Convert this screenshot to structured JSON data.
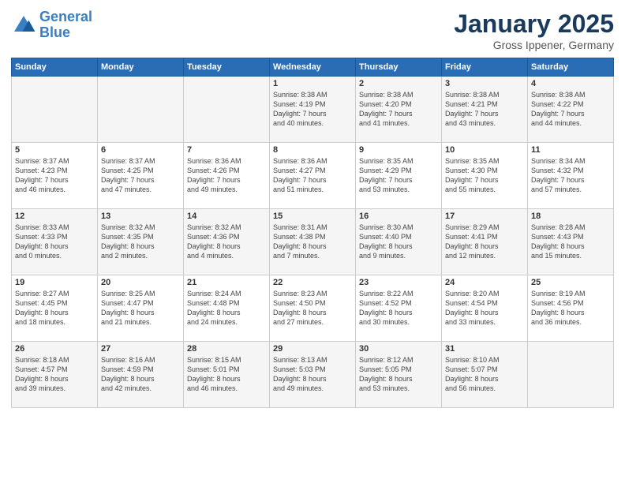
{
  "header": {
    "logo_line1": "General",
    "logo_line2": "Blue",
    "month_title": "January 2025",
    "location": "Gross Ippener, Germany"
  },
  "days_of_week": [
    "Sunday",
    "Monday",
    "Tuesday",
    "Wednesday",
    "Thursday",
    "Friday",
    "Saturday"
  ],
  "weeks": [
    [
      {
        "day": "",
        "content": ""
      },
      {
        "day": "",
        "content": ""
      },
      {
        "day": "",
        "content": ""
      },
      {
        "day": "1",
        "content": "Sunrise: 8:38 AM\nSunset: 4:19 PM\nDaylight: 7 hours\nand 40 minutes."
      },
      {
        "day": "2",
        "content": "Sunrise: 8:38 AM\nSunset: 4:20 PM\nDaylight: 7 hours\nand 41 minutes."
      },
      {
        "day": "3",
        "content": "Sunrise: 8:38 AM\nSunset: 4:21 PM\nDaylight: 7 hours\nand 43 minutes."
      },
      {
        "day": "4",
        "content": "Sunrise: 8:38 AM\nSunset: 4:22 PM\nDaylight: 7 hours\nand 44 minutes."
      }
    ],
    [
      {
        "day": "5",
        "content": "Sunrise: 8:37 AM\nSunset: 4:23 PM\nDaylight: 7 hours\nand 46 minutes."
      },
      {
        "day": "6",
        "content": "Sunrise: 8:37 AM\nSunset: 4:25 PM\nDaylight: 7 hours\nand 47 minutes."
      },
      {
        "day": "7",
        "content": "Sunrise: 8:36 AM\nSunset: 4:26 PM\nDaylight: 7 hours\nand 49 minutes."
      },
      {
        "day": "8",
        "content": "Sunrise: 8:36 AM\nSunset: 4:27 PM\nDaylight: 7 hours\nand 51 minutes."
      },
      {
        "day": "9",
        "content": "Sunrise: 8:35 AM\nSunset: 4:29 PM\nDaylight: 7 hours\nand 53 minutes."
      },
      {
        "day": "10",
        "content": "Sunrise: 8:35 AM\nSunset: 4:30 PM\nDaylight: 7 hours\nand 55 minutes."
      },
      {
        "day": "11",
        "content": "Sunrise: 8:34 AM\nSunset: 4:32 PM\nDaylight: 7 hours\nand 57 minutes."
      }
    ],
    [
      {
        "day": "12",
        "content": "Sunrise: 8:33 AM\nSunset: 4:33 PM\nDaylight: 8 hours\nand 0 minutes."
      },
      {
        "day": "13",
        "content": "Sunrise: 8:32 AM\nSunset: 4:35 PM\nDaylight: 8 hours\nand 2 minutes."
      },
      {
        "day": "14",
        "content": "Sunrise: 8:32 AM\nSunset: 4:36 PM\nDaylight: 8 hours\nand 4 minutes."
      },
      {
        "day": "15",
        "content": "Sunrise: 8:31 AM\nSunset: 4:38 PM\nDaylight: 8 hours\nand 7 minutes."
      },
      {
        "day": "16",
        "content": "Sunrise: 8:30 AM\nSunset: 4:40 PM\nDaylight: 8 hours\nand 9 minutes."
      },
      {
        "day": "17",
        "content": "Sunrise: 8:29 AM\nSunset: 4:41 PM\nDaylight: 8 hours\nand 12 minutes."
      },
      {
        "day": "18",
        "content": "Sunrise: 8:28 AM\nSunset: 4:43 PM\nDaylight: 8 hours\nand 15 minutes."
      }
    ],
    [
      {
        "day": "19",
        "content": "Sunrise: 8:27 AM\nSunset: 4:45 PM\nDaylight: 8 hours\nand 18 minutes."
      },
      {
        "day": "20",
        "content": "Sunrise: 8:25 AM\nSunset: 4:47 PM\nDaylight: 8 hours\nand 21 minutes."
      },
      {
        "day": "21",
        "content": "Sunrise: 8:24 AM\nSunset: 4:48 PM\nDaylight: 8 hours\nand 24 minutes."
      },
      {
        "day": "22",
        "content": "Sunrise: 8:23 AM\nSunset: 4:50 PM\nDaylight: 8 hours\nand 27 minutes."
      },
      {
        "day": "23",
        "content": "Sunrise: 8:22 AM\nSunset: 4:52 PM\nDaylight: 8 hours\nand 30 minutes."
      },
      {
        "day": "24",
        "content": "Sunrise: 8:20 AM\nSunset: 4:54 PM\nDaylight: 8 hours\nand 33 minutes."
      },
      {
        "day": "25",
        "content": "Sunrise: 8:19 AM\nSunset: 4:56 PM\nDaylight: 8 hours\nand 36 minutes."
      }
    ],
    [
      {
        "day": "26",
        "content": "Sunrise: 8:18 AM\nSunset: 4:57 PM\nDaylight: 8 hours\nand 39 minutes."
      },
      {
        "day": "27",
        "content": "Sunrise: 8:16 AM\nSunset: 4:59 PM\nDaylight: 8 hours\nand 42 minutes."
      },
      {
        "day": "28",
        "content": "Sunrise: 8:15 AM\nSunset: 5:01 PM\nDaylight: 8 hours\nand 46 minutes."
      },
      {
        "day": "29",
        "content": "Sunrise: 8:13 AM\nSunset: 5:03 PM\nDaylight: 8 hours\nand 49 minutes."
      },
      {
        "day": "30",
        "content": "Sunrise: 8:12 AM\nSunset: 5:05 PM\nDaylight: 8 hours\nand 53 minutes."
      },
      {
        "day": "31",
        "content": "Sunrise: 8:10 AM\nSunset: 5:07 PM\nDaylight: 8 hours\nand 56 minutes."
      },
      {
        "day": "",
        "content": ""
      }
    ]
  ]
}
